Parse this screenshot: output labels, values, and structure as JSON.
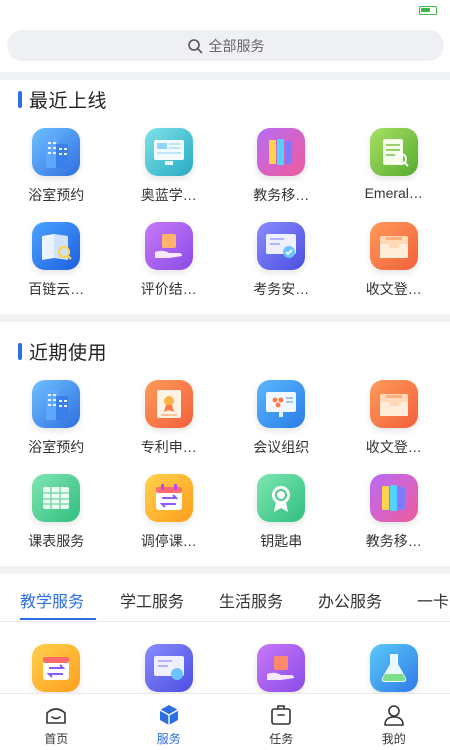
{
  "search": {
    "placeholder": "全部服务"
  },
  "recent_online": {
    "title": "最近上线",
    "apps": [
      {
        "label": "浴室预约",
        "icon": "building-icon"
      },
      {
        "label": "奥蓝学…",
        "icon": "monitor-icon"
      },
      {
        "label": "教务移…",
        "icon": "book-icon"
      },
      {
        "label": "Emeral…",
        "icon": "document-search-icon"
      },
      {
        "label": "百链云…",
        "icon": "book-search-icon"
      },
      {
        "label": "评价结…",
        "icon": "hand-card-icon"
      },
      {
        "label": "考务安…",
        "icon": "monitor-check-icon"
      },
      {
        "label": "收文登…",
        "icon": "inbox-icon"
      }
    ]
  },
  "recently_used": {
    "title": "近期使用",
    "apps": [
      {
        "label": "浴室预约",
        "icon": "building-icon"
      },
      {
        "label": "专利申…",
        "icon": "certificate-icon"
      },
      {
        "label": "会议组织",
        "icon": "meeting-board-icon"
      },
      {
        "label": "收文登…",
        "icon": "inbox-icon"
      },
      {
        "label": "课表服务",
        "icon": "table-icon"
      },
      {
        "label": "调停课…",
        "icon": "calendar-swap-icon"
      },
      {
        "label": "钥匙串",
        "icon": "badge-icon"
      },
      {
        "label": "教务移…",
        "icon": "book-icon"
      }
    ]
  },
  "category_tabs": [
    "教学服务",
    "学工服务",
    "生活服务",
    "办公服务",
    "一卡"
  ],
  "bottom_nav": [
    {
      "label": "首页",
      "icon": "home-icon"
    },
    {
      "label": "服务",
      "icon": "cube-icon"
    },
    {
      "label": "任务",
      "icon": "briefcase-icon"
    },
    {
      "label": "我的",
      "icon": "user-icon"
    }
  ],
  "colors": {
    "accent": "#2d6fe5",
    "status_battery": "#3cb54a"
  }
}
